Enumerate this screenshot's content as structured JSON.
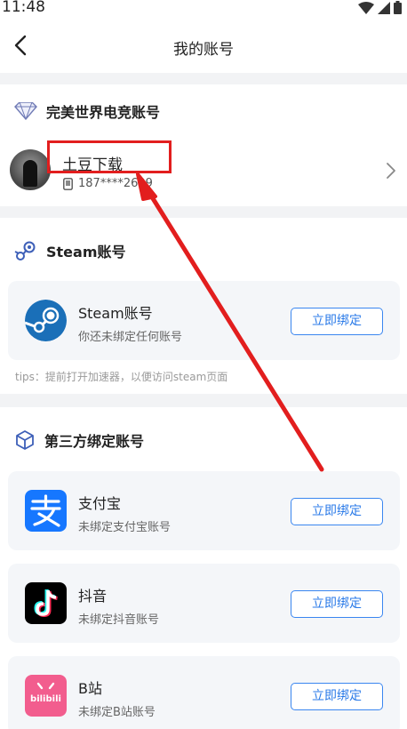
{
  "status_bar": {
    "time": "11:48"
  },
  "nav": {
    "title": "我的账号"
  },
  "perfect_world": {
    "title": "完美世界电竞账号",
    "user_name": "土豆下载",
    "phone": "187****2609"
  },
  "steam": {
    "title": "Steam账号",
    "card_name": "Steam账号",
    "card_desc": "你还未绑定任何账号",
    "bind_label": "立即绑定",
    "tips": "tips：提前打开加速器，以便访问steam页面"
  },
  "third_party": {
    "title": "第三方绑定账号",
    "items": [
      {
        "name": "支付宝",
        "desc": "未绑定支付宝账号",
        "bind_label": "立即绑定"
      },
      {
        "name": "抖音",
        "desc": "未绑定抖音账号",
        "bind_label": "立即绑定"
      },
      {
        "name": "B站",
        "desc": "未绑定B站账号",
        "bind_label": "立即绑定",
        "logo_text": "bilibili"
      }
    ]
  },
  "colors": {
    "accent": "#2a7ae8",
    "alipay": "#1677ff",
    "steam": "#1a6fb8",
    "bilibili": "#f25d8e",
    "annotation": "#e21e1e"
  },
  "icons": [
    "wifi-icon",
    "signal-icon",
    "battery-icon",
    "back-icon",
    "diamond-icon",
    "phone-icon",
    "chevron-right-icon",
    "steam-icon",
    "cube-icon"
  ]
}
